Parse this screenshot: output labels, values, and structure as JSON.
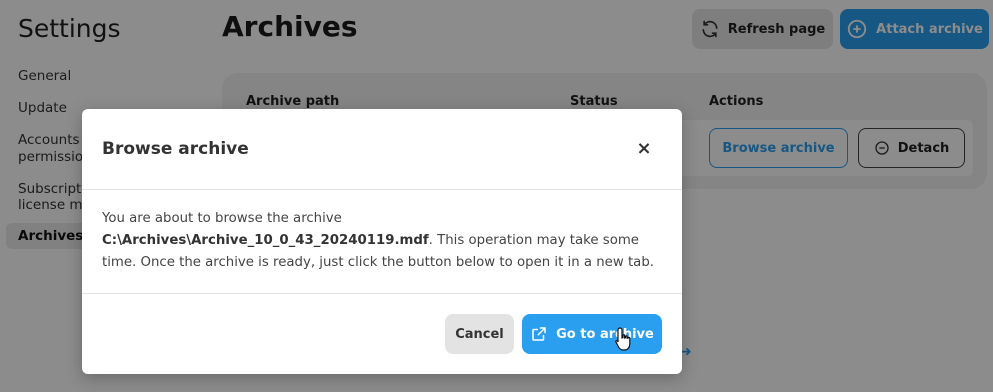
{
  "sidebar": {
    "title": "Settings",
    "items": [
      {
        "label": "General"
      },
      {
        "label": "Update"
      },
      {
        "label": "Accounts a"
      },
      {
        "label": "permissio"
      },
      {
        "label": "Subscripti"
      },
      {
        "label": "license ma"
      },
      {
        "label": "Archives"
      }
    ]
  },
  "header": {
    "title": "Archives",
    "refresh_label": "Refresh page",
    "attach_label": "Attach archive"
  },
  "table": {
    "columns": [
      "Archive path",
      "Status",
      "Actions"
    ],
    "row": {
      "browse_label": "Browse archive",
      "detach_label": "Detach"
    }
  },
  "modal": {
    "title": "Browse archive",
    "close_glyph": "×",
    "body_prefix": "You are about to browse the archive ",
    "archive_path": "C:\\Archives\\Archive_10_0_43_20240119.mdf",
    "body_suffix": ". This operation may take some time. Once the archive is ready, just click the button below to open it in a new tab.",
    "cancel_label": "Cancel",
    "go_label": "Go to archive"
  },
  "colors": {
    "accent": "#2a9ff0",
    "overlay": "rgba(0,0,0,0.45)"
  },
  "icons": [
    "refresh-icon",
    "plus-circle-icon",
    "minus-circle-icon",
    "close-icon",
    "external-link-icon",
    "hand-cursor-icon"
  ]
}
